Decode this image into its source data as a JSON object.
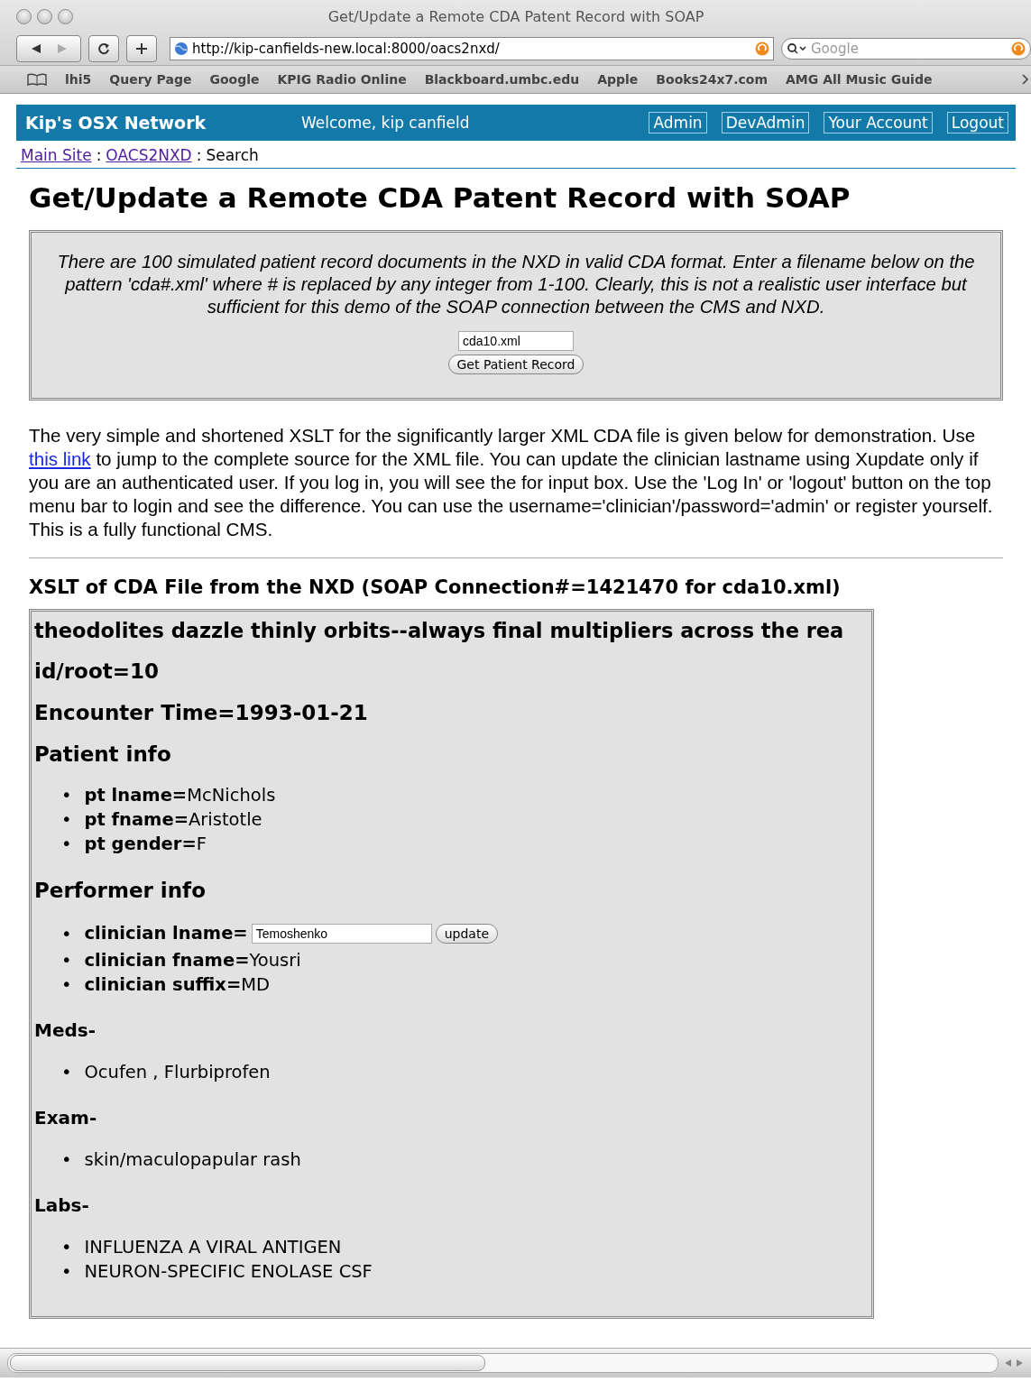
{
  "window": {
    "title": "Get/Update a Remote CDA Patent Record with SOAP"
  },
  "toolbar": {
    "url": "http://kip-canfields-new.local:8000/oacs2nxd/",
    "search_placeholder": "Google"
  },
  "bookmarks": [
    "lhi5",
    "Query Page",
    "Google",
    "KPIG Radio Online",
    "Blackboard.umbc.edu",
    "Apple",
    "Books24x7.com",
    "AMG All Music Guide"
  ],
  "site_nav": {
    "brand": "Kip's OSX Network",
    "welcome": "Welcome, kip canfield",
    "links": [
      "Admin",
      "DevAdmin",
      "Your Account",
      "Logout"
    ]
  },
  "breadcrumb": {
    "separator": ":",
    "items": [
      {
        "label": "Main Site",
        "kind": "link"
      },
      {
        "label": "OACS2NXD",
        "kind": "link"
      },
      {
        "label": "Search",
        "kind": "text"
      }
    ]
  },
  "heading": "Get/Update a Remote CDA Patent Record with SOAP",
  "intro": {
    "text": "There are 100 simulated patient record documents in the NXD in valid CDA format. Enter a filename below on the pattern 'cda#.xml' where # is replaced by any integer from 1-100. Clearly, this is not a realistic user interface but sufficient for this demo of the SOAP connection between the CMS and NXD.",
    "filename": "cda10.xml",
    "button": "Get Patient Record"
  },
  "description": {
    "before": "The very simple and shortened XSLT for the significantly larger XML CDA file is given below for demonstration. Use ",
    "link": "this link",
    "after": " to jump to the complete source for the XML file. You can update the clinician lastname using Xupdate only if you are an authenticated user. If you log in, you will see the for input box. Use the 'Log In' or 'logout' button on the top menu bar to login and see the difference. You can use the username='clinician'/password='admin' or register yourself. This is a fully functional CMS."
  },
  "section_heading": "XSLT of CDA File from the NXD (SOAP Connection#=1421470 for cda10.xml)",
  "record": {
    "title": "theodolites dazzle thinly orbits--always final multipliers across the rea",
    "blocks": [
      {
        "kind": "major",
        "text": "id/root=10"
      },
      {
        "kind": "major",
        "text": "Encounter Time=1993-01-21"
      },
      {
        "kind": "major",
        "text": "Patient info"
      },
      {
        "kind": "list",
        "marker": "•",
        "items": [
          {
            "kind": "pair",
            "text": "**pt lname=**McNichols"
          },
          {
            "kind": "pair",
            "text": "**pt fname=**Aristotle"
          },
          {
            "kind": "pair",
            "text": "**pt gender=**F"
          }
        ]
      },
      {
        "kind": "major",
        "text": "Performer info"
      },
      {
        "kind": "list",
        "marker": "•",
        "items": [
          {
            "kind": "field",
            "label": "clinician lname=",
            "value": "Temoshenko",
            "button": "update"
          },
          {
            "kind": "pair",
            "text": "**clinician fname=**Yousri"
          },
          {
            "kind": "pair",
            "text": "**clinician suffix=**MD"
          }
        ]
      },
      {
        "kind": "minor",
        "text": "Meds-"
      },
      {
        "kind": "list",
        "marker": "•",
        "items": [
          {
            "kind": "plain",
            "text": "Ocufen , Flurbiprofen"
          }
        ]
      },
      {
        "kind": "minor",
        "text": "Exam-"
      },
      {
        "kind": "list",
        "marker": "•",
        "items": [
          {
            "kind": "plain",
            "text": "skin/maculopapular rash"
          }
        ]
      },
      {
        "kind": "minor",
        "text": "Labs-"
      },
      {
        "kind": "list",
        "marker": "•",
        "items": [
          {
            "kind": "plain",
            "text": "INFLUENZA A VIRAL ANTIGEN"
          },
          {
            "kind": "plain",
            "text": "NEURON-SPECIFIC ENOLASE CSF"
          }
        ]
      }
    ]
  }
}
